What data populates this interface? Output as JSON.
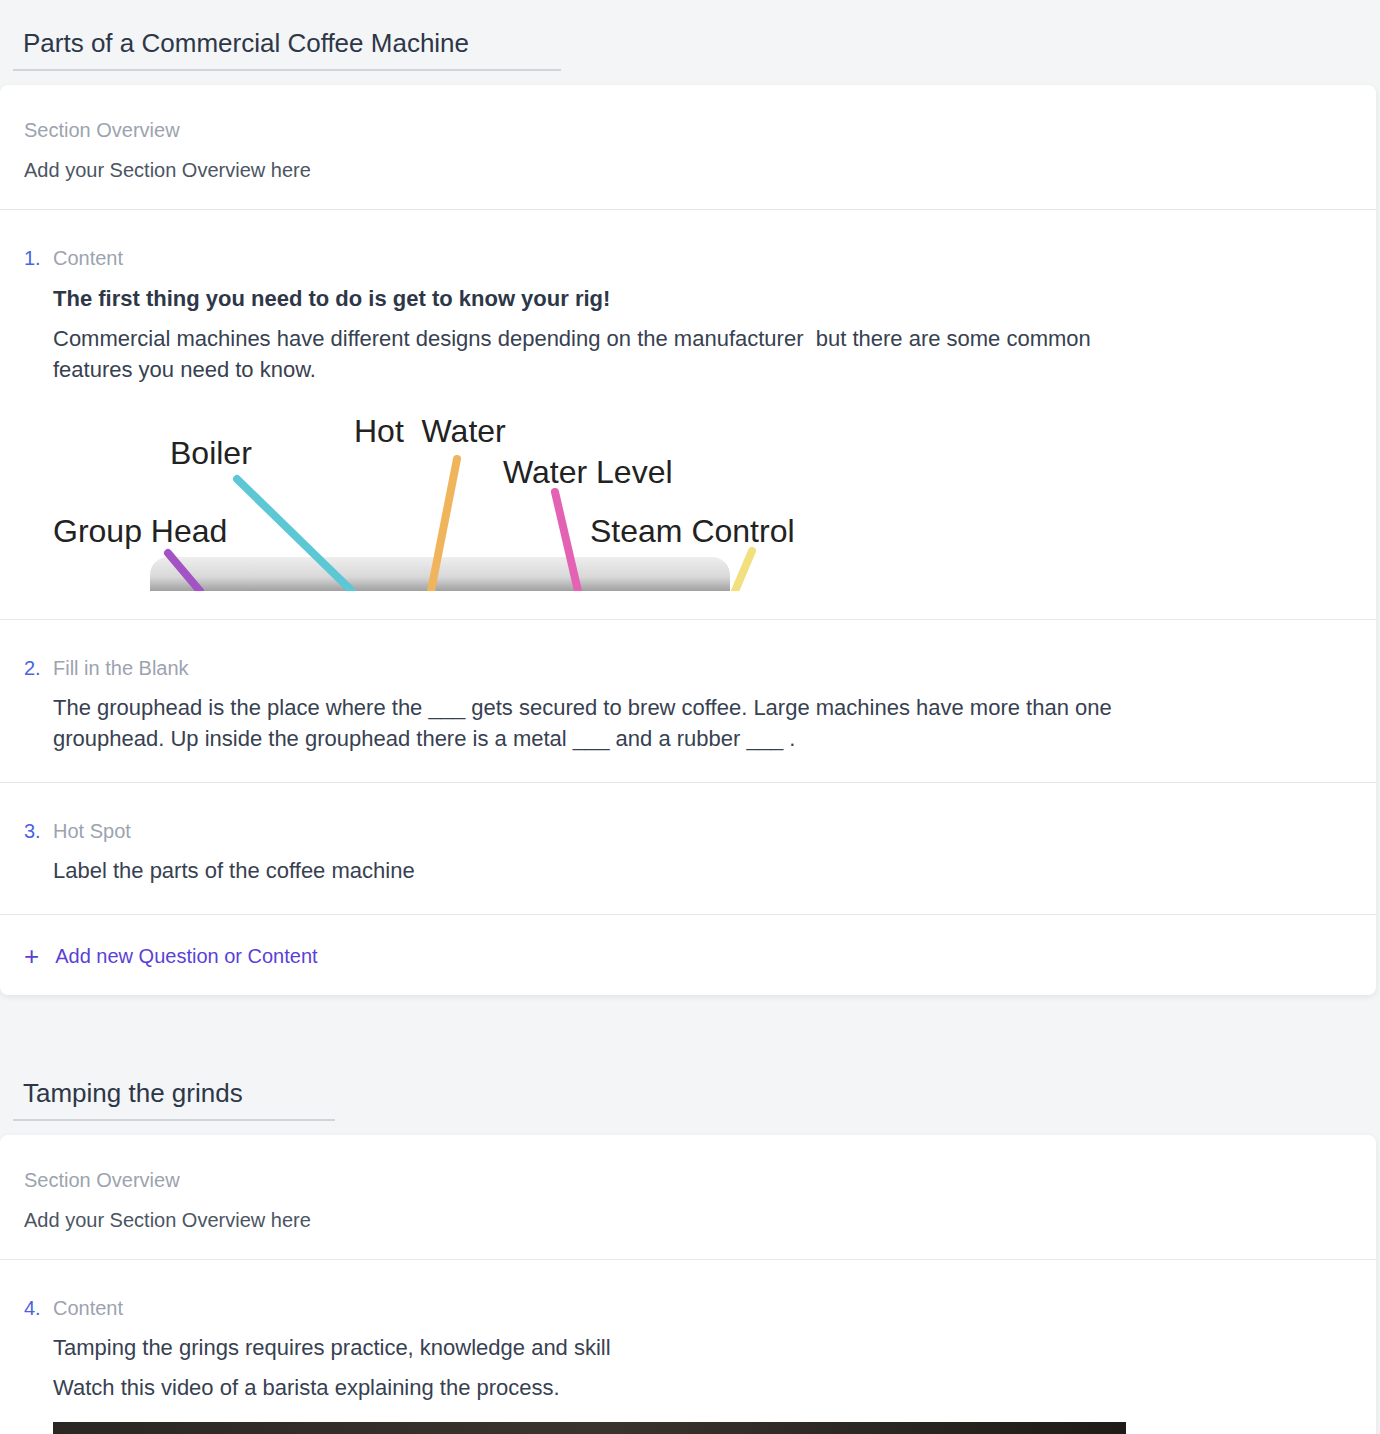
{
  "sections": [
    {
      "title": "Parts of a Commercial Coffee Machine",
      "overview_label": "Section Overview",
      "overview": "Add your Section Overview here",
      "items": [
        {
          "number": "1.",
          "type": "Content",
          "kind": "diagram",
          "heading": "The first thing you need to do is get to know your rig!",
          "paragraphs": [
            "Commercial machines have different designs depending on the manufacturer  but there are some common features you need to know."
          ],
          "labels": [
            {
              "text": "Boiler",
              "color": "#5ec7d6"
            },
            {
              "text": "Hot  Water",
              "color": "#f0b55c"
            },
            {
              "text": "Water Level",
              "color": "#e462b4"
            },
            {
              "text": "Steam Control",
              "color": "#f2e07e"
            },
            {
              "text": "Group Head",
              "color": "#a354c4"
            }
          ]
        },
        {
          "number": "2.",
          "type": "Fill in the Blank",
          "kind": "text",
          "paragraphs": [
            "The grouphead is the place where the ___ gets secured to brew coffee. Large machines have more than one grouphead. Up inside the grouphead there is a metal ___ and a rubber ___ ."
          ]
        },
        {
          "number": "3.",
          "type": "Hot Spot",
          "kind": "text",
          "paragraphs": [
            "Label the parts of the coffee machine"
          ]
        }
      ],
      "add": {
        "icon": "+",
        "label": "Add new Question or Content"
      }
    },
    {
      "title": "Tamping the grinds",
      "overview_label": "Section Overview",
      "overview": "Add your Section Overview here",
      "items": [
        {
          "number": "4.",
          "type": "Content",
          "kind": "video",
          "paragraphs": [
            "Tamping the grings requires practice, knowledge and skill",
            "Watch this video of a barista explaining the process."
          ]
        }
      ]
    }
  ]
}
